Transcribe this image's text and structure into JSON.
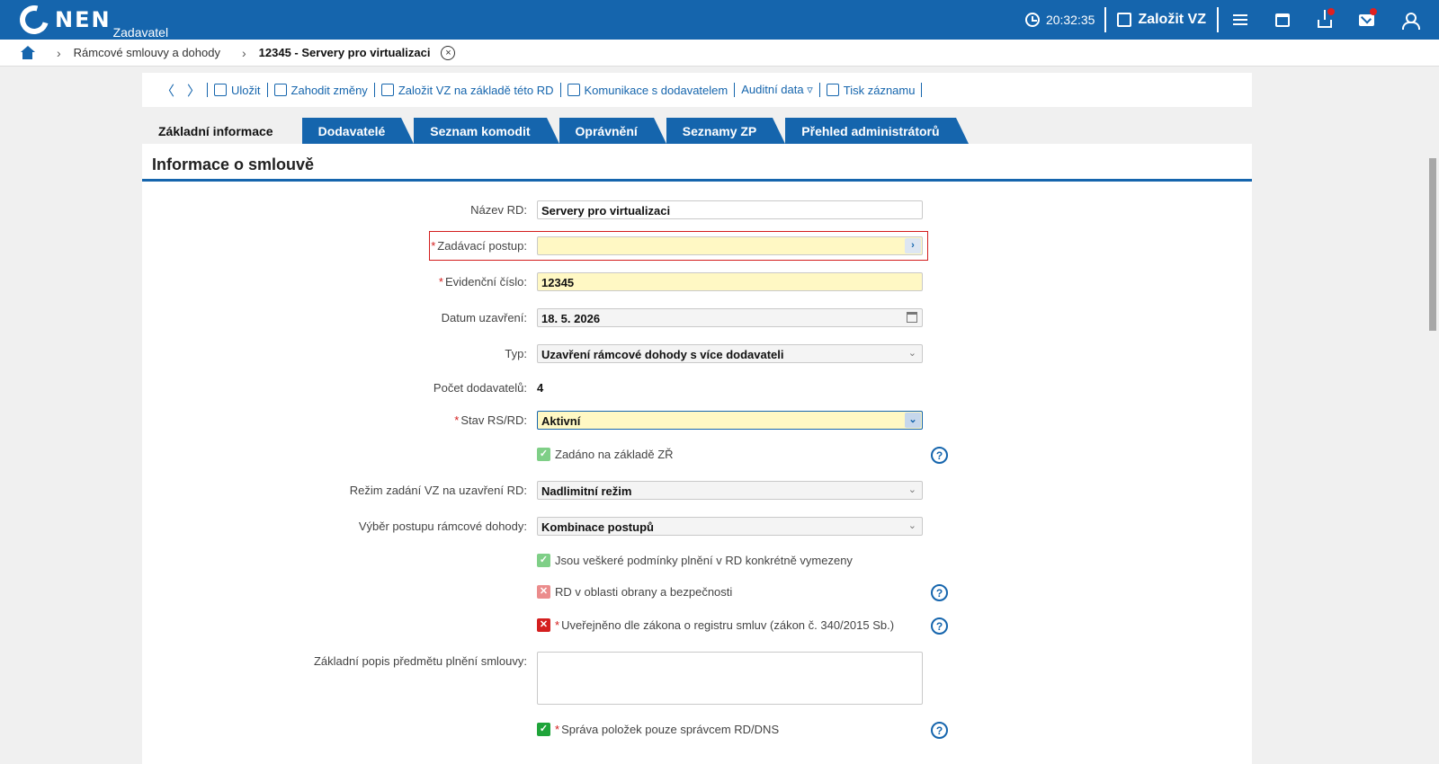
{
  "topbar": {
    "logo_text": "NEN",
    "logo_sub": "Zadavatel",
    "clock": "20:32:35",
    "create_label": "Založit VZ"
  },
  "breadcrumb": {
    "items": [
      "Rámcové smlouvy a dohody",
      "12345 - Servery pro virtualizaci"
    ],
    "close_glyph": "×"
  },
  "toolbar": {
    "back": "〈",
    "forward": "〉",
    "save": "Uložit",
    "discard": "Zahodit změny",
    "create_vz": "Založit VZ na základě této RD",
    "communication": "Komunikace s dodavatelem",
    "audit": "Auditní data ▿",
    "print": "Tisk záznamu"
  },
  "tabs": [
    "Základní informace",
    "Dodavatelé",
    "Seznam komodit",
    "Oprávnění",
    "Seznamy ZP",
    "Přehled administrátorů"
  ],
  "panel": {
    "title": "Informace o smlouvě",
    "fields": {
      "nazev_rd": {
        "label": "Název RD:",
        "value": "Servery pro virtualizaci"
      },
      "zadavaci_postup": {
        "label": "Zadávací postup:",
        "value": ""
      },
      "evidencni_cislo": {
        "label": "Evidenční číslo:",
        "value": "12345"
      },
      "datum_uzavreni": {
        "label": "Datum uzavření:",
        "value": "18. 5. 2026"
      },
      "typ": {
        "label": "Typ:",
        "value": "Uzavření rámcové dohody s více dodavateli"
      },
      "pocet_dodavatelu": {
        "label": "Počet dodavatelů:",
        "value": "4"
      },
      "stav": {
        "label": "Stav RS/RD:",
        "value": "Aktivní"
      },
      "zadano_zr": {
        "label": "Zadáno na základě ZŘ",
        "checked": true
      },
      "rezim": {
        "label": "Režim zadání VZ na uzavření RD:",
        "value": "Nadlimitní režim"
      },
      "vyber_postupu": {
        "label": "Výběr postupu rámcové dohody:",
        "value": "Kombinace postupů"
      },
      "podminky": {
        "label": "Jsou veškeré podmínky plnění v RD konkrétně vymezeny",
        "checked": true
      },
      "obrana": {
        "label": "RD v oblasti obrany a bezpečnosti",
        "checked": false
      },
      "uverejneno": {
        "label": "Uveřejněno dle zákona o registru smluv (zákon č. 340/2015 Sb.)",
        "checked": false
      },
      "popis": {
        "label": "Základní popis předmětu plnění smlouvy:",
        "value": ""
      },
      "sprava_polozek": {
        "label": "Správa položek pouze správcem RD/DNS",
        "checked": true
      }
    },
    "required_mark": "*",
    "help_glyph": "?",
    "check_glyph": "✓",
    "cross_glyph": "✕",
    "chevron_glyph": "⌄",
    "next_glyph": "›"
  }
}
